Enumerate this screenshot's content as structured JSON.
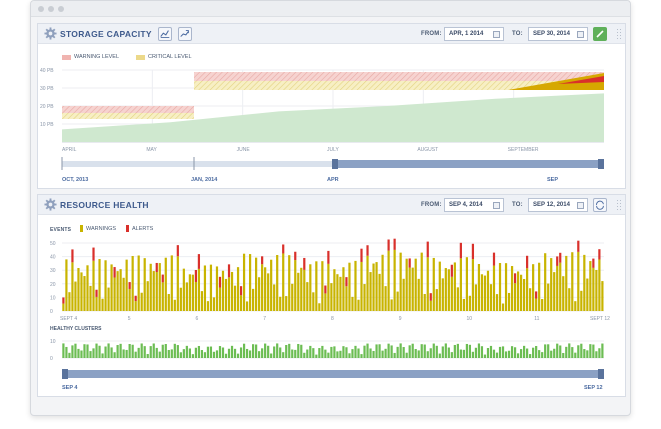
{
  "storage": {
    "title": "STORAGE CAPACITY",
    "from_label": "FROM:",
    "from_value": "APR, 1 2014",
    "to_label": "TO:",
    "to_value": "SEP 30, 2014",
    "legend": {
      "warning": "WARNING LEVEL",
      "critical": "CRITICAL LEVEL"
    },
    "y_ticks": [
      "40 PB",
      "30 PB",
      "20 PB",
      "10 PB"
    ],
    "months": [
      "APRIL",
      "MAY",
      "JUNE",
      "JULY",
      "AUGUST",
      "SEPTEMBER"
    ],
    "range_labels": [
      "OCT, 2013",
      "JAN, 2014",
      "APR",
      "SEP"
    ]
  },
  "health": {
    "title": "RESOURCE HEALTH",
    "from_label": "FROM:",
    "from_value": "SEP 4, 2014",
    "to_label": "TO:",
    "to_value": "SEP 12, 2014",
    "events_label": "EVENTS",
    "legend": {
      "warnings": "WARNINGS",
      "alerts": "ALERTS"
    },
    "events_y_ticks": [
      "50",
      "40",
      "30",
      "20",
      "10",
      "0"
    ],
    "day_labels": [
      "SEPT 4",
      "5",
      "6",
      "7",
      "8",
      "9",
      "10",
      "11",
      "SEPT 12"
    ],
    "clusters_label": "HEALTHY CLUSTERS",
    "clusters_y_ticks": [
      "10",
      "0"
    ],
    "range_labels": [
      "SEP 4",
      "SEP 12"
    ]
  },
  "colors": {
    "accent": "#3e5a8c",
    "warning": "#c8b400",
    "alert": "#d9302b",
    "healthy": "#6cbd53",
    "capacity_fill": "#cfe8cf"
  },
  "chart_data": [
    {
      "type": "area",
      "title": "STORAGE CAPACITY",
      "x": [
        "APRIL",
        "MAY",
        "JUNE",
        "JULY",
        "AUGUST",
        "SEPTEMBER"
      ],
      "series": [
        {
          "name": "",
          "values": [
            7,
            11,
            17,
            20,
            24,
            27
          ]
        }
      ],
      "ylim": [
        0,
        40
      ],
      "ylabel": "",
      "xlabel": "",
      "grid": true,
      "legend": "top-left"
    },
    {
      "type": "bar",
      "title": "EVENTS",
      "categories": [
        "SEPT 4",
        "5",
        "6",
        "7",
        "8",
        "9",
        "10",
        "11",
        "SEPT 12"
      ],
      "series": [
        {
          "name": "WARNINGS",
          "values": [
            28,
            30,
            25,
            31,
            27,
            33,
            29,
            26,
            32
          ]
        },
        {
          "name": "ALERTS",
          "values": [
            6,
            5,
            7,
            4,
            6,
            5,
            7,
            6,
            5
          ]
        }
      ],
      "ylim": [
        0,
        50
      ],
      "grid": true,
      "legend": "top-left"
    },
    {
      "type": "bar",
      "title": "HEALTHY CLUSTERS",
      "categories": [
        "SEPT 4",
        "5",
        "6",
        "7",
        "8",
        "9",
        "10",
        "11",
        "SEPT 12"
      ],
      "series": [
        {
          "name": "",
          "values": [
            6,
            6,
            5,
            6,
            5,
            6,
            6,
            5,
            6
          ]
        }
      ],
      "ylim": [
        0,
        10
      ],
      "grid": true
    }
  ]
}
